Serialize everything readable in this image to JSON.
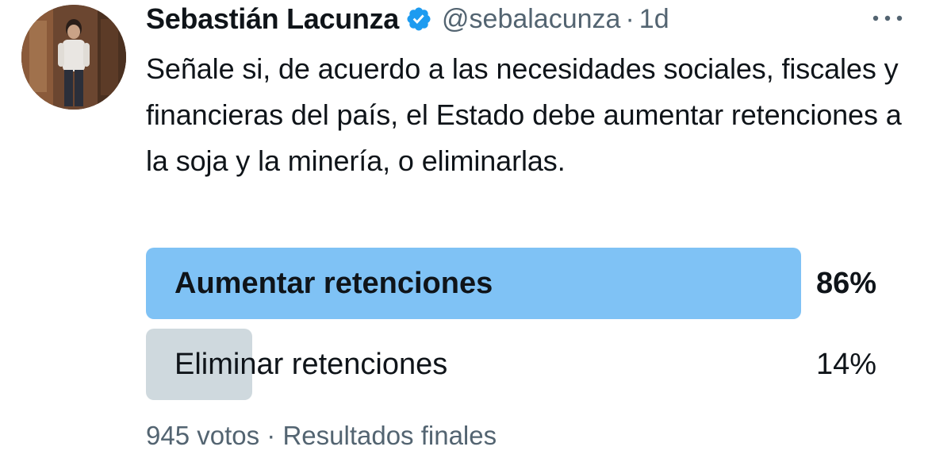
{
  "tweet": {
    "author_name": "Sebastián Lacunza",
    "handle": "@sebalacunza",
    "separator": "·",
    "time": "1d",
    "verified_color": "#1d9bf0",
    "avatar_icon": "profile-photo",
    "text": "Señale si, de acuerdo a las necesidades sociales, fiscales y financieras del país, el Estado debe aumentar retenciones a la soja y la minería, o eliminarlas."
  },
  "poll": {
    "options": [
      {
        "label": "Aumentar retenciones",
        "percent_text": "86%",
        "fraction": 0.86,
        "winner": true,
        "bar_color": "#7fc2f5"
      },
      {
        "label": "Eliminar retenciones",
        "percent_text": "14%",
        "fraction": 0.14,
        "winner": false,
        "bar_color": "#cfd9de"
      }
    ],
    "votes": "945 votos",
    "footer_separator": "·",
    "status": "Resultados finales"
  }
}
